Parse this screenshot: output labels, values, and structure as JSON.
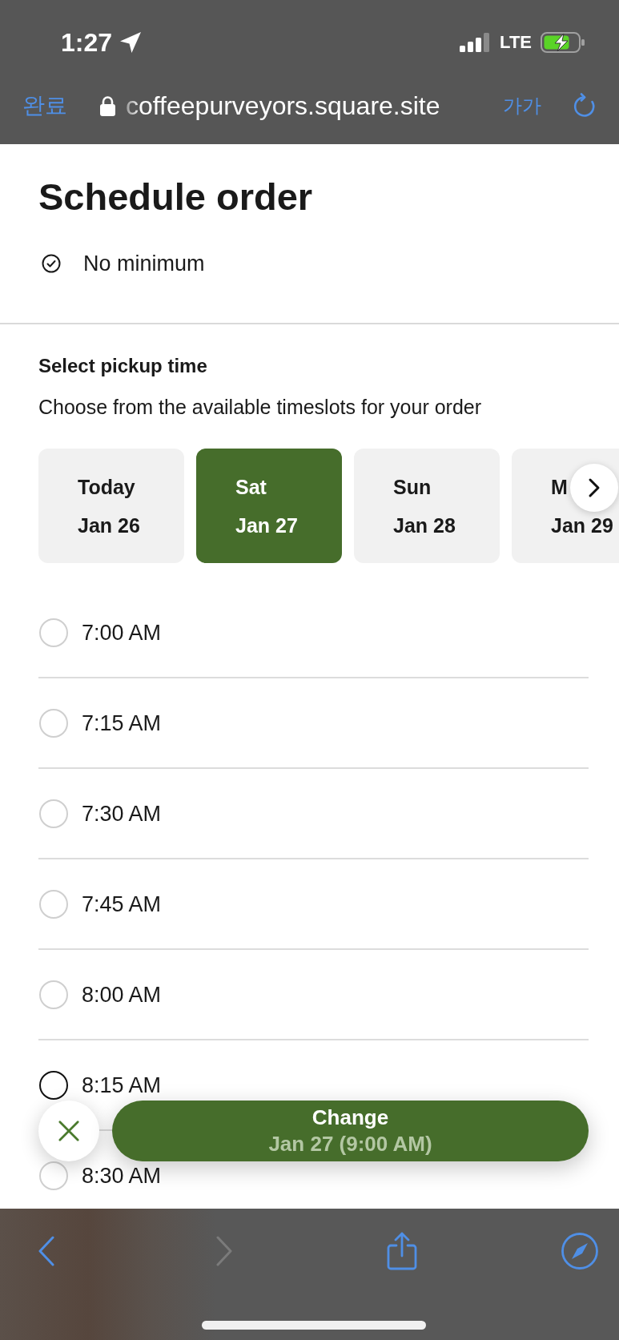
{
  "status_bar": {
    "time": "1:27",
    "network": "LTE"
  },
  "browser_bar": {
    "done": "완료",
    "url": "coffeepurveyors.square.site",
    "text_size": "가가"
  },
  "page": {
    "title": "Schedule order",
    "note": "No minimum"
  },
  "pickup": {
    "heading": "Select pickup time",
    "description": "Choose from the available timeslots for your order",
    "days": [
      {
        "day": "Today",
        "date": "Jan 26",
        "selected": false
      },
      {
        "day": "Sat",
        "date": "Jan 27",
        "selected": true
      },
      {
        "day": "Sun",
        "date": "Jan 28",
        "selected": false
      },
      {
        "day": "M",
        "date": "Jan 29",
        "selected": false
      }
    ],
    "slots": [
      {
        "time": "7:00 AM",
        "selected": false,
        "focused": false
      },
      {
        "time": "7:15 AM",
        "selected": false,
        "focused": false
      },
      {
        "time": "7:30 AM",
        "selected": false,
        "focused": false
      },
      {
        "time": "7:45 AM",
        "selected": false,
        "focused": false
      },
      {
        "time": "8:00 AM",
        "selected": false,
        "focused": false
      },
      {
        "time": "8:15 AM",
        "selected": false,
        "focused": true
      },
      {
        "time": "8:30 AM",
        "selected": false,
        "focused": false
      }
    ]
  },
  "action": {
    "label": "Change",
    "detail": "Jan 27 (9:00 AM)"
  },
  "toolbar": {
    "buttons": [
      {
        "kind": "back",
        "disabled": false
      },
      {
        "kind": "forward",
        "disabled": true
      },
      {
        "kind": "share",
        "disabled": false
      },
      {
        "kind": "compass",
        "disabled": false
      }
    ]
  }
}
